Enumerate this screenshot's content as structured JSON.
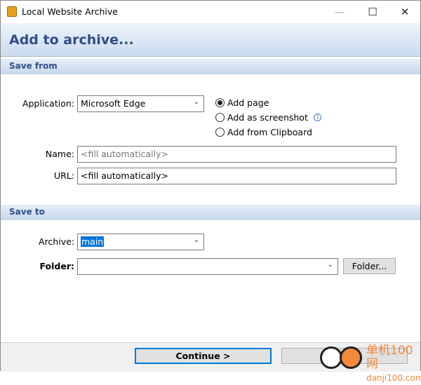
{
  "window": {
    "title": "Local Website Archive",
    "app_icon": "archive-download-icon"
  },
  "header": {
    "title": "Add to archive..."
  },
  "save_from": {
    "section_label": "Save from",
    "application_label": "Application:",
    "application_value": "Microsoft Edge",
    "options": [
      {
        "label": "Add page",
        "selected": true
      },
      {
        "label": "Add as screenshot",
        "selected": false,
        "info_icon": "info-icon"
      },
      {
        "label": "Add from Clipboard",
        "selected": false
      }
    ],
    "name_label": "Name:",
    "name_placeholder": "<fill automatically>",
    "url_label": "URL:",
    "url_value": "<fill automatically>"
  },
  "save_to": {
    "section_label": "Save to",
    "archive_label": "Archive:",
    "archive_value": "main",
    "folder_label": "Folder:",
    "folder_value": "",
    "folder_button": "Folder..."
  },
  "footer": {
    "continue_label": "Continue >",
    "second_button_label": ""
  },
  "watermark": {
    "text": "单机100网",
    "url": "danji100.com"
  },
  "colors": {
    "accent": "#2f4d86",
    "selection": "#0078d7"
  }
}
